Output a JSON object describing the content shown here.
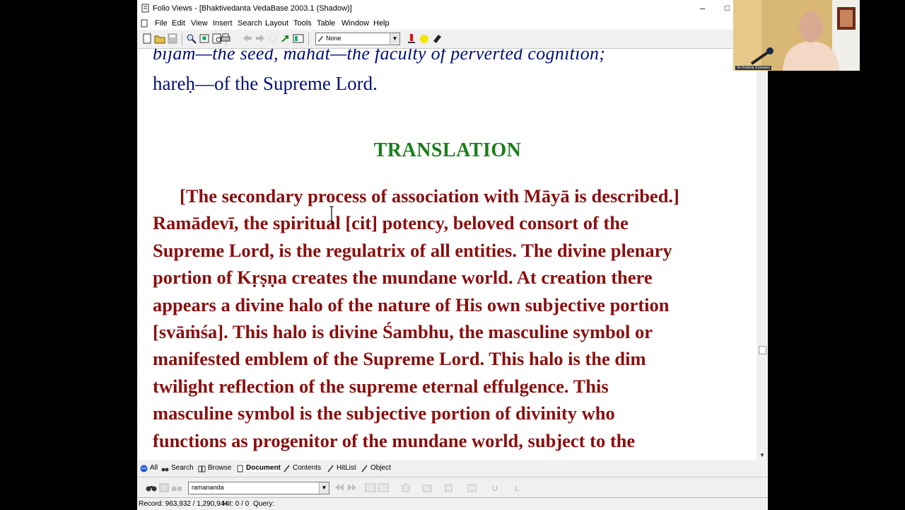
{
  "window": {
    "title": "Folio Views - [Bhaktivedanta VedaBase 2003.1 (Shadow)]",
    "minimize_glyph": "–",
    "maximize_glyph": "□"
  },
  "menu": [
    "File",
    "Edit",
    "View",
    "Insert",
    "Search",
    "Layout",
    "Tools",
    "Table",
    "Window",
    "Help"
  ],
  "toolbar": {
    "style_combo_value": "None"
  },
  "document": {
    "top_line_1": "bījam—the seed, mahat—the faculty of perverted cognition;",
    "top_line_2": "hareḥ—of the Supreme Lord.",
    "heading": "TRANSLATION",
    "paragraph_lines": [
      "[The secondary process of association with Māyā is described.]",
      "Ramādevī, the spiritual [cit] potency, beloved consort of the",
      "Supreme Lord, is the regulatrix of all entities. The divine plenary",
      "portion of Kṛṣṇa creates the mundane world. At creation there",
      "appears a divine halo of the nature of His own subjective portion",
      "[svāṁśa]. This halo is divine Śambhu, the masculine symbol or",
      "manifested emblem of the Supreme Lord. This halo is the dim",
      "twilight reflection of the supreme eternal effulgence. This",
      "masculine symbol is the subjective portion of divinity who",
      "functions as progenitor of the mundane world, subject to the"
    ]
  },
  "tabs": [
    "All",
    "Search",
    "Browse",
    "Document",
    "Contents",
    "HitList",
    "Object"
  ],
  "active_tab": "Document",
  "search": {
    "query_value": "ramananda"
  },
  "status": {
    "record": "Record: 963,932 / 1,290,944",
    "hit": "Hit: 0 / 0",
    "query": "Query:"
  },
  "video_overlay": {
    "caption": "Sir Krishna Goswami"
  },
  "colors": {
    "translation_heading": "#1a7f1a",
    "translation_text": "#8a0f0f",
    "synonym_text": "#000f7a"
  }
}
